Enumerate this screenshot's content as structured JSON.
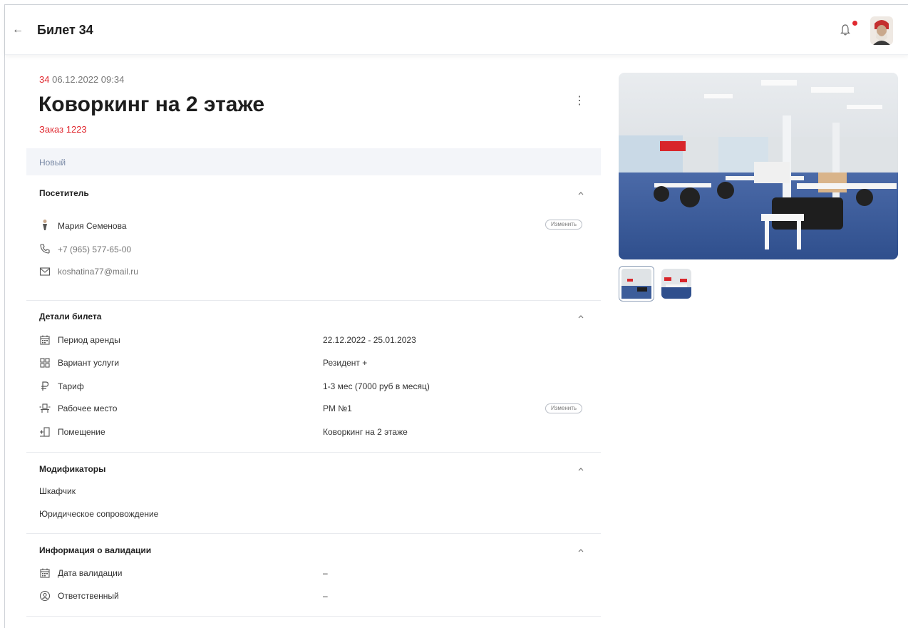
{
  "header": {
    "title": "Билет 34",
    "back_icon": "arrow-left-icon",
    "bell_icon": "bell-icon",
    "notification_color": "#e0282f"
  },
  "ticket": {
    "number": "34",
    "datetime": "06.12.2022 09:34",
    "title": "Коворкинг на 2 этаже",
    "order": "Заказ 1223",
    "status": "Новый",
    "more_icon": "more-vertical-icon"
  },
  "visitor": {
    "section_title": "Посетитель",
    "name": "Мария Семенова",
    "phone": "+7 (965) 577-65-00",
    "email": "koshatina77@mail.ru",
    "change_label": "Изменить"
  },
  "details": {
    "section_title": "Детали билета",
    "rows": [
      {
        "icon": "calendar-icon",
        "label": "Период аренды",
        "value": "22.12.2022 - 25.01.2023"
      },
      {
        "icon": "grid-icon",
        "label": "Вариант услуги",
        "value": "Резидент +"
      },
      {
        "icon": "ruble-icon",
        "label": "Тариф",
        "value": "1-3 мес (7000 руб в месяц)"
      },
      {
        "icon": "workplace-icon",
        "label": "Рабочее место",
        "value": "РМ №1"
      },
      {
        "icon": "door-icon",
        "label": "Помещение",
        "value": "Коворкинг на 2 этаже"
      }
    ],
    "change_label": "Изменить"
  },
  "modifiers": {
    "section_title": "Модификаторы",
    "items": [
      "Шкафчик",
      "Юридическое сопровождение"
    ]
  },
  "validation": {
    "section_title": "Информация о валидации",
    "rows": [
      {
        "icon": "calendar-icon",
        "label": "Дата валидации",
        "value": "–"
      },
      {
        "icon": "user-circle-icon",
        "label": "Ответственный",
        "value": "–"
      }
    ]
  },
  "colors": {
    "accent": "#e0282f",
    "status_bg": "#f3f5f9",
    "status_text": "#7a8aa6"
  }
}
